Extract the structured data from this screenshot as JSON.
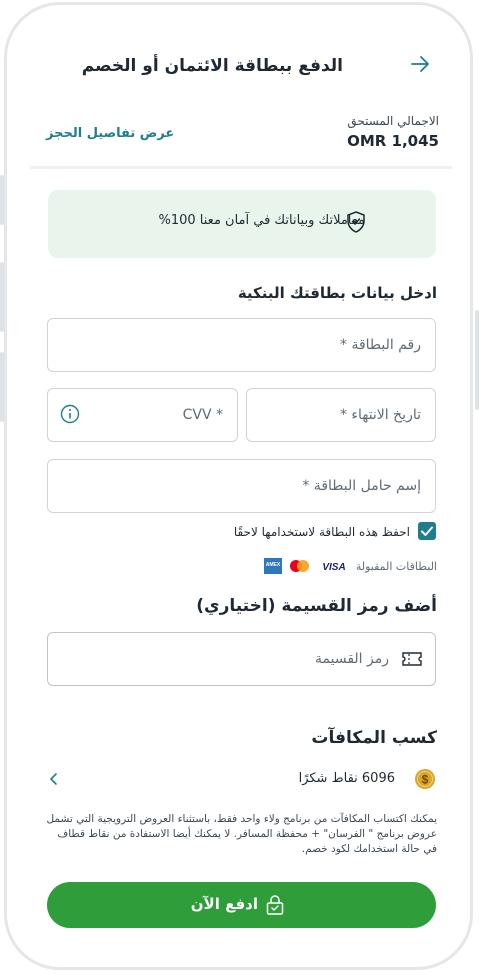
{
  "header": {
    "title": "الدفع ببطاقة الائتمان أو الخصم",
    "back_icon": "arrow-icon"
  },
  "summary": {
    "total_label": "الاجمالي المستحق",
    "total_value": "OMR 1,045",
    "details_link": "عرض تفاصيل الحجز"
  },
  "security": {
    "message": "معاملاتك وبياناتك في آمان معنا 100%",
    "icon": "shield-check-icon"
  },
  "card_form": {
    "title": "ادخل بيانات بطاقتك البنكية",
    "card_number_placeholder": "رقم البطاقة *",
    "expiry_placeholder": "تاريخ الانتهاء *",
    "cvv_placeholder": "CVV *",
    "holder_placeholder": "إسم حامل البطاقة *",
    "save_card_label": "احفظ هذه البطاقة لاستخدامها لاحقًا",
    "save_card_checked": true,
    "accepted_label": "البطاقات المقبولة",
    "accepted_cards": [
      "VISA",
      "mastercard",
      "AMEX"
    ]
  },
  "promo": {
    "title": "أضف رمز القسيمة (اختياري)",
    "placeholder": "رمز القسيمة"
  },
  "rewards": {
    "title": "كسب المكافآت",
    "points": "6096 نقاط شكرًا",
    "disclaimer": "يمكنك اكتساب المكافآت من برنامج ولاء واحد فقط، باستثناء العروض الترويجية التي تشمل عروض برنامج \" الفرسان\" + محفظة المسافر. لا يمكنك أيضا الاستفادة من نقاط قطاف في حالة استخدامك لكود خصم."
  },
  "pay_button": {
    "label": "ادفع الآن"
  },
  "colors": {
    "accent": "#1f7d8c",
    "pay_green": "#2f9e3a",
    "secure_bg": "#e8f4ec"
  }
}
